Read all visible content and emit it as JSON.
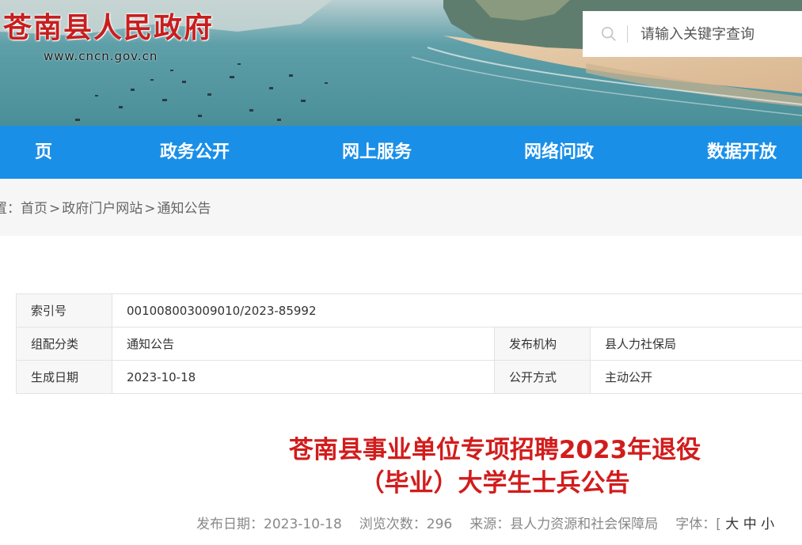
{
  "header": {
    "site_title": "苍南县人民政府",
    "site_url": "www.cncn.gov.cn",
    "search_placeholder": "请输入关键字查询"
  },
  "nav": {
    "items": [
      {
        "label": "页"
      },
      {
        "label": "政务公开"
      },
      {
        "label": "网上服务"
      },
      {
        "label": "网络问政"
      },
      {
        "label": "数据开放"
      }
    ],
    "color": "#1a8fe8"
  },
  "breadcrumb": {
    "prefix": "置：",
    "items": [
      "首页",
      "政府门户网站",
      "通知公告"
    ],
    "separator": ">"
  },
  "info": {
    "index_label": "索引号",
    "index_value": "001008003009010/2023-85992",
    "category_label": "组配分类",
    "category_value": "通知公告",
    "publisher_label": "发布机构",
    "publisher_value": "县人力社保局",
    "date_label": "生成日期",
    "date_value": "2023-10-18",
    "disclosure_label": "公开方式",
    "disclosure_value": "主动公开"
  },
  "article": {
    "title_line1": "苍南县事业单位专项招聘2023年退役",
    "title_line2": "（毕业）大学生士兵公告",
    "title_color": "#d21c1c",
    "publish_date": "发布日期：2023-10-18",
    "views": "浏览次数：296",
    "source": "来源：县人力资源和社会保障局",
    "font_size_label": "字体：[",
    "font_large": "大",
    "font_medium": "中",
    "font_small": "小"
  }
}
